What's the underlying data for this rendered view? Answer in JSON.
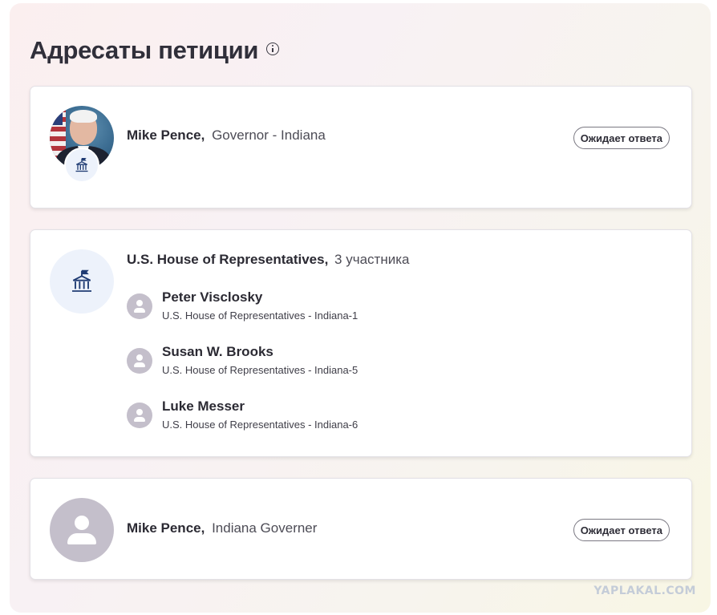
{
  "header": {
    "title": "Адресаты петиции",
    "info_icon": "info-icon"
  },
  "recipients": [
    {
      "name": "Mike Pence,",
      "role": "Governor - Indiana",
      "status": "Ожидает ответа",
      "avatar": "photo",
      "badge_icon": "government-building-icon"
    },
    {
      "group_name": "U.S. House of Representatives,",
      "group_count": "3 участника",
      "icon": "government-building-icon",
      "members": [
        {
          "name": "Peter Visclosky",
          "role": "U.S. House of Representatives - Indiana-1"
        },
        {
          "name": "Susan W. Brooks",
          "role": "U.S. House of Representatives - Indiana-5"
        },
        {
          "name": "Luke Messer",
          "role": "U.S. House of Representatives - Indiana-6"
        }
      ]
    },
    {
      "name": "Mike Pence,",
      "role": "Indiana Governer",
      "status": "Ожидает ответа",
      "avatar": "default-person-icon"
    }
  ],
  "watermark": "YAPLAKAL.COM",
  "colors": {
    "icon_blue": "#1f3b73",
    "avatar_grey": "#c4bfcb",
    "badge_bg": "#edf2fb"
  }
}
